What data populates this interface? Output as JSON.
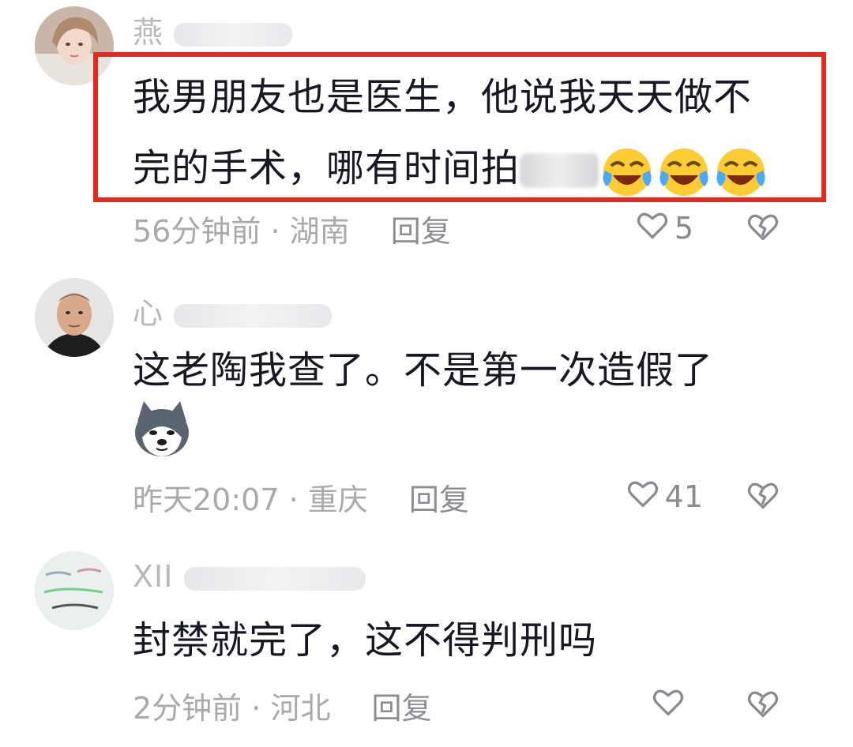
{
  "comments": [
    {
      "username_visible": "燕",
      "text_line1": "我男朋友也是医生，他说我天天做不",
      "text_line2_prefix": "完的手术，哪有时间拍",
      "emojis": [
        "laughing-crying-emoji",
        "laughing-crying-emoji",
        "laughing-crying-emoji"
      ],
      "time": "56分钟前",
      "location": "湖南",
      "reply_label": "回复",
      "likes": "5"
    },
    {
      "username_visible": "心",
      "text": "这老陶我查了。不是第一次造假了",
      "sticker": "husky-dog-emoji",
      "time": "昨天20:07",
      "location": "重庆",
      "reply_label": "回复",
      "likes": "41"
    },
    {
      "username_visible": "XII",
      "text": "封禁就完了，这不得判刑吗",
      "time": "2分钟前",
      "location": "河北",
      "reply_label": "回复",
      "likes": ""
    }
  ],
  "separator": " · ",
  "colors": {
    "highlight_border": "#e8281e",
    "meta_text": "#a9a9ae",
    "body_text": "#161823"
  },
  "icons": [
    "heart-icon",
    "broken-heart-icon"
  ]
}
